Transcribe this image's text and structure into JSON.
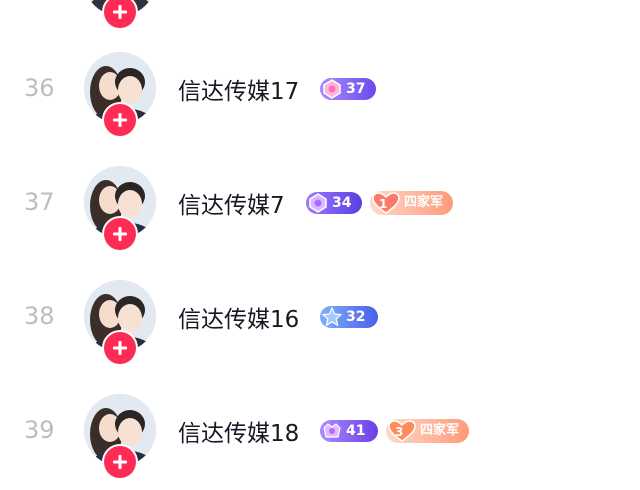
{
  "colors": {
    "follow_button": "#fe2c55",
    "rank_text": "#bdbdbd",
    "name_text": "#161823",
    "level_purple": "#7b5cf0",
    "fan_badge": "#ff9a7a"
  },
  "rows": [
    {
      "rank": "36",
      "name": "信达传媒17",
      "level": "37",
      "level_icon": "gem-icon",
      "fan": null
    },
    {
      "rank": "37",
      "name": "信达传媒7",
      "level": "34",
      "level_icon": "gem-icon",
      "fan": {
        "number": "1",
        "label": "四家军"
      }
    },
    {
      "rank": "38",
      "name": "信达传媒16",
      "level": "32",
      "level_icon": "star-icon",
      "fan": null
    },
    {
      "rank": "39",
      "name": "信达传媒18",
      "level": "41",
      "level_icon": "crown-gem-icon",
      "fan": {
        "number": "3",
        "label": "四家军"
      }
    }
  ]
}
